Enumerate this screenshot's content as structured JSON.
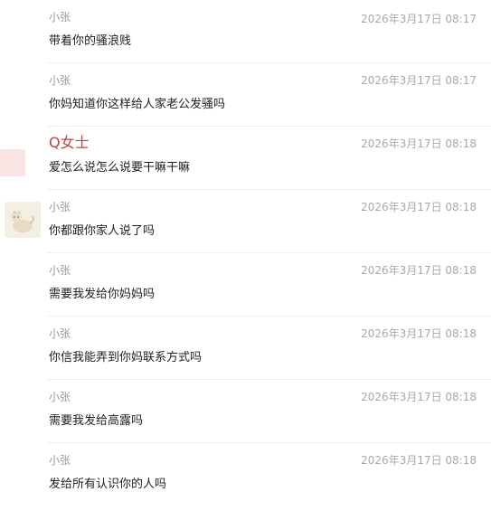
{
  "messages": [
    {
      "sender": "小张",
      "time": "2026年3月17日 08:17",
      "content": "带着你的骚浪贱"
    },
    {
      "sender": "小张",
      "time": "2026年3月17日 08:17",
      "content": "你妈知道你这样给人家老公发骚吗"
    },
    {
      "sender": "Q女士",
      "time": "2026年3月17日 08:18",
      "content": "爱怎么说怎么说要干嘛干嘛"
    },
    {
      "sender": "小张",
      "time": "2026年3月17日 08:18",
      "content": "你都跟你家人说了吗"
    },
    {
      "sender": "小张",
      "time": "2026年3月17日 08:18",
      "content": "需要我发给你妈妈吗"
    },
    {
      "sender": "小张",
      "time": "2026年3月17日 08:18",
      "content": "你信我能弄到你妈联系方式吗"
    },
    {
      "sender": "小张",
      "time": "2026年3月17日 08:18",
      "content": "需要我发给高露吗"
    },
    {
      "sender": "小张",
      "time": "2026年3月17日 08:18",
      "content": "发给所有认识你的人吗"
    }
  ],
  "colors": {
    "sender_default": "#9a9a9a",
    "sender_highlight": "#b04848",
    "timestamp": "#a9a9a9",
    "content": "#1e1e1e"
  }
}
